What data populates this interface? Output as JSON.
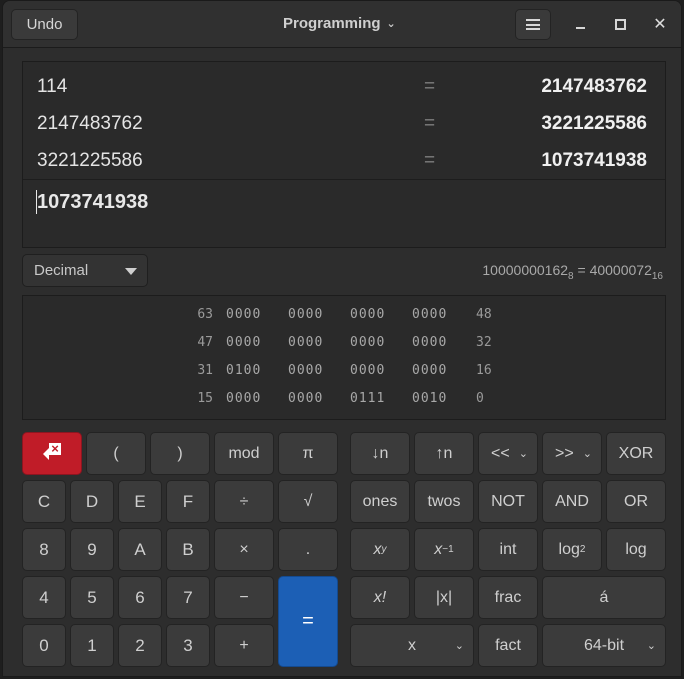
{
  "titlebar": {
    "undo_label": "Undo",
    "mode_label": "Programming"
  },
  "history": [
    {
      "expr": "114",
      "eq": "=",
      "result": "2147483762"
    },
    {
      "expr": "2147483762",
      "eq": "=",
      "result": "3221225586"
    },
    {
      "expr": "3221225586",
      "eq": "=",
      "result": "1073741938"
    }
  ],
  "entry": "1073741938",
  "base": {
    "selected": "Decimal",
    "octal_value": "10000000162",
    "octal_base": "8",
    "equals": "=",
    "hex_value": "40000072",
    "hex_base": "16"
  },
  "bits": [
    {
      "left": "63",
      "groups": [
        "0000",
        "0000",
        "0000",
        "0000"
      ],
      "right": "48"
    },
    {
      "left": "47",
      "groups": [
        "0000",
        "0000",
        "0000",
        "0000"
      ],
      "right": "32"
    },
    {
      "left": "31",
      "groups": [
        "0100",
        "0000",
        "0000",
        "0000"
      ],
      "right": "16"
    },
    {
      "left": "15",
      "groups": [
        "0000",
        "0000",
        "0111",
        "0010"
      ],
      "right": "0"
    }
  ],
  "keys": {
    "lparen": "(",
    "rparen": ")",
    "mod": "mod",
    "pi": "π",
    "shr_n": "↓n",
    "shl_n": "↑n",
    "shl": "<<",
    "shr": ">>",
    "xor": "XOR",
    "c": "C",
    "d": "D",
    "e": "E",
    "f": "F",
    "div": "÷",
    "sqrt": "√",
    "ones": "ones",
    "twos": "twos",
    "not": "NOT",
    "and": "AND",
    "or": "OR",
    "k8": "8",
    "k9": "9",
    "a": "A",
    "b": "B",
    "mul": "×",
    "dot": ".",
    "pow_base": "x",
    "pow_exp": "y",
    "inv_base": "x",
    "inv_exp": "−1",
    "int": "int",
    "log2_base": "log",
    "log2_sub": "2",
    "log": "log",
    "k4": "4",
    "k5": "5",
    "k6": "6",
    "k7": "7",
    "sub": "−",
    "eq": "=",
    "fact_x": "x!",
    "abs": "|x|",
    "frac": "frac",
    "accent": "á",
    "k0": "0",
    "k1": "1",
    "k2": "2",
    "k3": "3",
    "add": "+",
    "var_x": "x",
    "fact": "fact",
    "wordsize": "64-bit"
  }
}
